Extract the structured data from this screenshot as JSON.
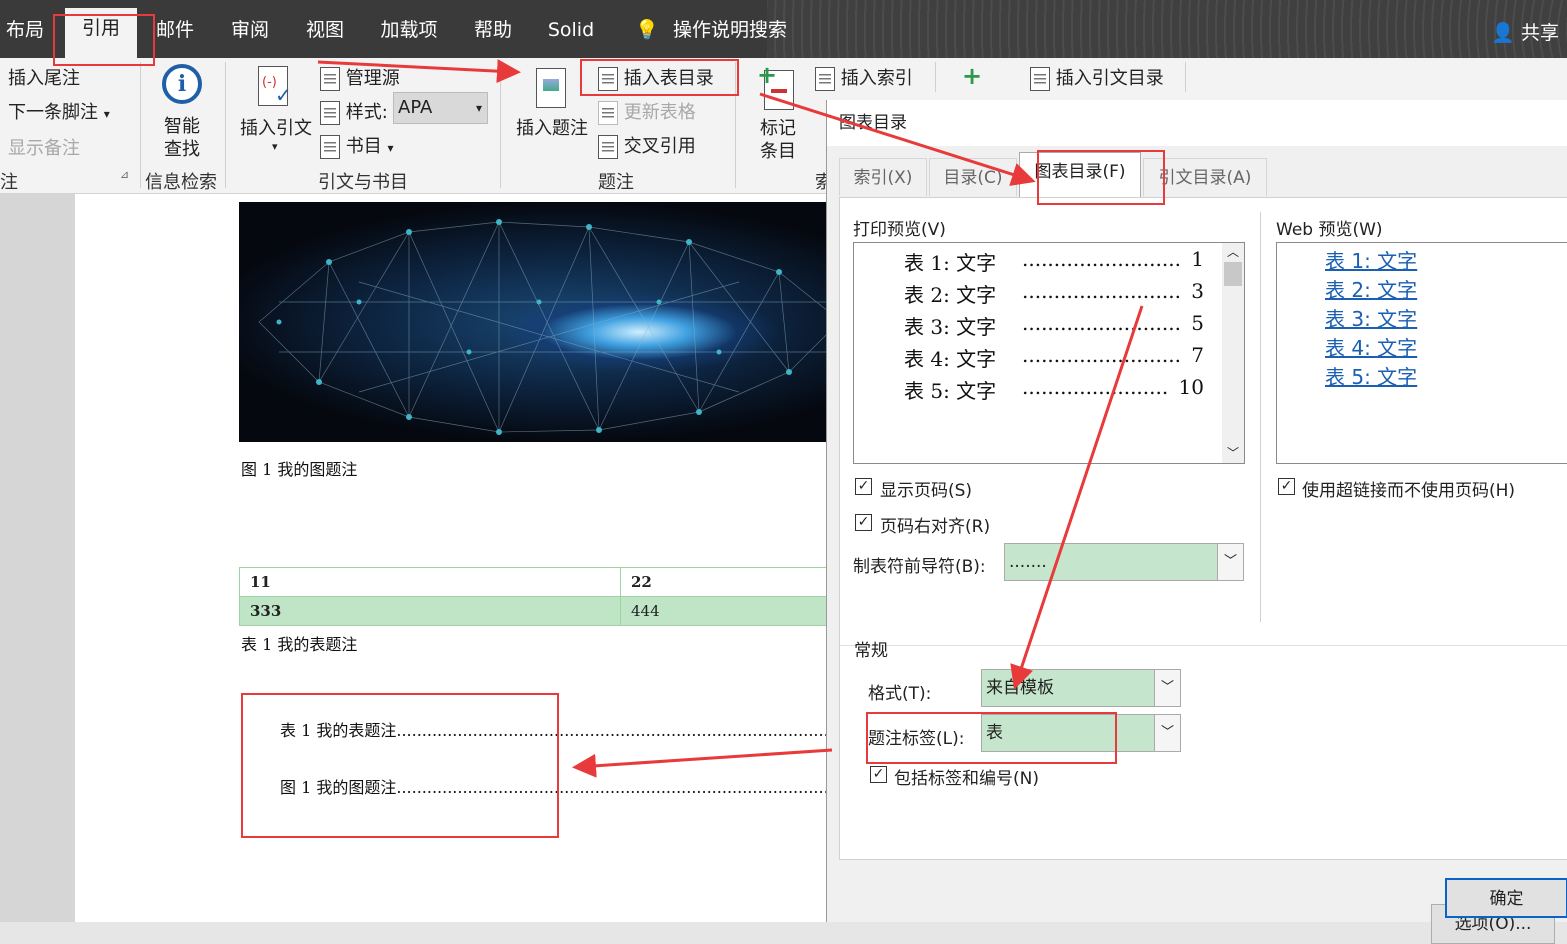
{
  "tabs": [
    "布局",
    "引用",
    "邮件",
    "审阅",
    "视图",
    "加载项",
    "帮助",
    "Solid",
    "操作说明搜索"
  ],
  "share_label": "共享",
  "ribbon": {
    "insert_endnote": "插入尾注",
    "next_footnote": "下一条脚注",
    "show_notes": "显示备注",
    "footnotes_group": "注",
    "smart_lookup_l1": "智能",
    "smart_lookup_l2": "查找",
    "research_group": "信息检索",
    "insert_citation": "插入引文",
    "manage_sources": "管理源",
    "style_label": "样式:",
    "style_value": "APA",
    "bibliography": "书目",
    "citations_group": "引文与书目",
    "insert_caption": "插入题注",
    "insert_table_of_figures": "插入表目录",
    "update_table": "更新表格",
    "cross_reference": "交叉引用",
    "captions_group": "题注",
    "mark_entry_l1": "标记",
    "mark_entry_l2": "条目",
    "insert_index": "插入索引",
    "index_group": "索",
    "insert_toa": "插入引文目录"
  },
  "document": {
    "figure_caption": "图 1 我的图题注",
    "table_rows": [
      [
        "11",
        "22"
      ],
      [
        "333",
        "444"
      ]
    ],
    "table_caption": "表 1 我的表题注",
    "tof_entries": [
      "表 1 我的表题注..........................................................................................",
      "图 1 我的图题注.........................................................................................."
    ]
  },
  "dialog": {
    "title": "图表目录",
    "tabs": [
      "索引(X)",
      "目录(C)",
      "图表目录(F)",
      "引文目录(A)"
    ],
    "print_preview_label": "打印预览(V)",
    "print_preview": [
      {
        "text": "表 1: 文字",
        "page": "1"
      },
      {
        "text": "表 2: 文字",
        "page": "3"
      },
      {
        "text": "表 3: 文字",
        "page": "5"
      },
      {
        "text": "表 4: 文字",
        "page": "7"
      },
      {
        "text": "表 5: 文字",
        "page": "10"
      }
    ],
    "web_preview_label": "Web 预览(W)",
    "web_preview": [
      "表 1: 文字",
      "表 2: 文字",
      "表 3: 文字",
      "表 4: 文字",
      "表 5: 文字"
    ],
    "show_page_numbers": "显示页码(S)",
    "right_align": "页码右对齐(R)",
    "use_hyperlinks": "使用超链接而不使用页码(H)",
    "tab_leader_label": "制表符前导符(B):",
    "tab_leader_value": ".......",
    "general_label": "常规",
    "formats_label": "格式(T):",
    "formats_value": "来自模板",
    "caption_label_label": "题注标签(L):",
    "caption_label_value": "表",
    "include_label": "包括标签和编号(N)",
    "options_button": "选项(O)...",
    "ok_button": "确定"
  },
  "colors": {
    "accent_red": "#e83a3a",
    "combo_green": "#c5e6cc",
    "link_blue": "#1a5fb4"
  }
}
